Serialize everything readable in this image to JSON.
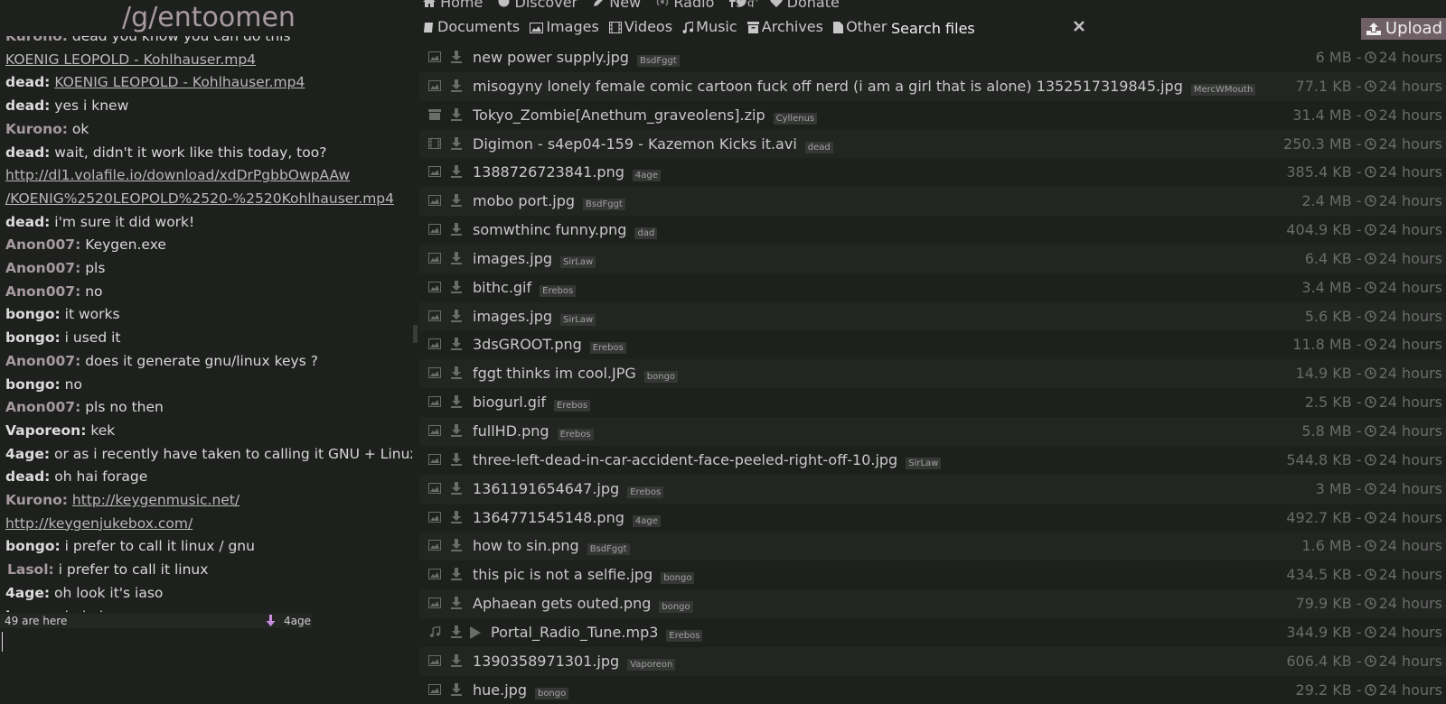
{
  "room": {
    "title": "/g/entoomen"
  },
  "chat": {
    "partial_top": {
      "nick": "Kurono:",
      "text": " dead you know you can do this"
    },
    "messages": [
      {
        "nick": "",
        "text": "",
        "link": "KOENIG LEOPOLD - Kohlhauser.mp4"
      },
      {
        "nick": "dead:",
        "text": " ",
        "link": "KOENIG LEOPOLD - Kohlhauser.mp4"
      },
      {
        "nick": "dead:",
        "text": " yes i knew",
        "link": ""
      },
      {
        "nick": "Kurono:",
        "text": " ok",
        "link": ""
      },
      {
        "nick": "dead:",
        "text": " wait, didn't it work like this today, too?",
        "link": ""
      },
      {
        "nick": "",
        "text": "",
        "link": "http://dl1.volafile.io/download/xdDrPgbbOwpAAw"
      },
      {
        "nick": "",
        "text": "",
        "link": "/KOENIG%2520LEOPOLD%2520-%2520Kohlhauser.mp4"
      },
      {
        "nick": "dead:",
        "text": " i'm sure it did work!",
        "link": ""
      },
      {
        "nick": "Anon007:",
        "text": " Keygen.exe",
        "link": ""
      },
      {
        "nick": "Anon007:",
        "text": " pls",
        "link": ""
      },
      {
        "nick": "Anon007:",
        "text": " no",
        "link": ""
      },
      {
        "nick": "bongo:",
        "text": " it works",
        "link": ""
      },
      {
        "nick": "bongo:",
        "text": " i used it",
        "link": ""
      },
      {
        "nick": "Anon007:",
        "text": " does it generate gnu/linux keys ?",
        "link": ""
      },
      {
        "nick": "bongo:",
        "text": " no",
        "link": ""
      },
      {
        "nick": "Anon007:",
        "text": " pls no then",
        "link": ""
      },
      {
        "nick": "Vaporeon:",
        "text": " kek",
        "link": ""
      },
      {
        "nick": "4age:",
        "text": " or as i recently have taken to calling it GNU + Linux",
        "link": ""
      },
      {
        "nick": "dead:",
        "text": " oh hai forage",
        "link": ""
      },
      {
        "nick": "Kurono:",
        "text": " ",
        "link": "http://keygenmusic.net/"
      },
      {
        "nick": "",
        "text": "",
        "link": "http://keygenjukebox.com/"
      },
      {
        "nick": "bongo:",
        "text": " i prefer to call it linux / gnu",
        "link": ""
      },
      {
        "nick": "Lasol:",
        "text": " i prefer to call it linux",
        "link": ""
      },
      {
        "nick": "4age:",
        "text": " oh look it's iaso",
        "link": ""
      },
      {
        "nick": "bongo:",
        "text": " helo iaso",
        "link": ""
      }
    ],
    "user_count": "49 are here",
    "active_user": "4age",
    "input_value": ""
  },
  "nav": {
    "home": "Home",
    "discover": "Discover",
    "new": "New",
    "radio": "Radio",
    "donate": "Donate"
  },
  "filters": {
    "documents": "Documents",
    "images": "Images",
    "videos": "Videos",
    "music": "Music",
    "archives": "Archives",
    "other": "Other",
    "search_placeholder": "Search files",
    "upload": "Upload"
  },
  "files": [
    {
      "type": "image",
      "name": "new power supply.jpg",
      "user": "BsdFggt",
      "size": "6 MB",
      "age": "24 hours"
    },
    {
      "type": "image",
      "name": "misogyny lonely female comic cartoon fuck off nerd (i am a girl that is alone) 1352517319845.jpg",
      "user": "MercWMouth",
      "size": "77.1 KB",
      "age": "24 hours"
    },
    {
      "type": "archive",
      "name": "Tokyo_Zombie[Anethum_graveolens].zip",
      "user": "Cyllenus",
      "size": "31.4 MB",
      "age": "24 hours"
    },
    {
      "type": "video",
      "name": "Digimon - s4ep04-159 - Kazemon Kicks it.avi",
      "user": "dead",
      "size": "250.3 MB",
      "age": "24 hours"
    },
    {
      "type": "image",
      "name": "1388726723841.png",
      "user": "4age",
      "size": "385.4 KB",
      "age": "24 hours"
    },
    {
      "type": "image",
      "name": "mobo port.jpg",
      "user": "BsdFggt",
      "size": "2.4 MB",
      "age": "24 hours"
    },
    {
      "type": "image",
      "name": "somwthinc funny.png",
      "user": "dad",
      "size": "404.9 KB",
      "age": "24 hours"
    },
    {
      "type": "image",
      "name": "images.jpg",
      "user": "SirLaw",
      "size": "6.4 KB",
      "age": "24 hours"
    },
    {
      "type": "image",
      "name": "bithc.gif",
      "user": "Erebos",
      "size": "3.4 MB",
      "age": "24 hours"
    },
    {
      "type": "image",
      "name": "images.jpg",
      "user": "SirLaw",
      "size": "5.6 KB",
      "age": "24 hours"
    },
    {
      "type": "image",
      "name": "3dsGROOT.png",
      "user": "Erebos",
      "size": "11.8 MB",
      "age": "24 hours"
    },
    {
      "type": "image",
      "name": "fggt thinks im cool.JPG",
      "user": "bongo",
      "size": "14.9 KB",
      "age": "24 hours"
    },
    {
      "type": "image",
      "name": "biogurl.gif",
      "user": "Erebos",
      "size": "2.5 KB",
      "age": "24 hours"
    },
    {
      "type": "image",
      "name": "fullHD.png",
      "user": "Erebos",
      "size": "5.8 MB",
      "age": "24 hours"
    },
    {
      "type": "image",
      "name": "three-left-dead-in-car-accident-face-peeled-right-off-10.jpg",
      "user": "SirLaw",
      "size": "544.8 KB",
      "age": "24 hours"
    },
    {
      "type": "image",
      "name": "1361191654647.jpg",
      "user": "Erebos",
      "size": "3 MB",
      "age": "24 hours"
    },
    {
      "type": "image",
      "name": "1364771545148.png",
      "user": "4age",
      "size": "492.7 KB",
      "age": "24 hours"
    },
    {
      "type": "image",
      "name": "how to sin.png",
      "user": "BsdFggt",
      "size": "1.6 MB",
      "age": "24 hours"
    },
    {
      "type": "image",
      "name": "this pic is not a selfie.jpg",
      "user": "bongo",
      "size": "434.5 KB",
      "age": "24 hours"
    },
    {
      "type": "image",
      "name": "Aphaean gets outed.png",
      "user": "bongo",
      "size": "79.9 KB",
      "age": "24 hours"
    },
    {
      "type": "audio",
      "name": "Portal_Radio_Tune.mp3",
      "user": "Erebos",
      "size": "344.9 KB",
      "age": "24 hours"
    },
    {
      "type": "image",
      "name": "1390358971301.jpg",
      "user": "Vaporeon",
      "size": "606.4 KB",
      "age": "24 hours"
    },
    {
      "type": "image",
      "name": "hue.jpg",
      "user": "bongo",
      "size": "29.2 KB",
      "age": "24 hours"
    }
  ]
}
